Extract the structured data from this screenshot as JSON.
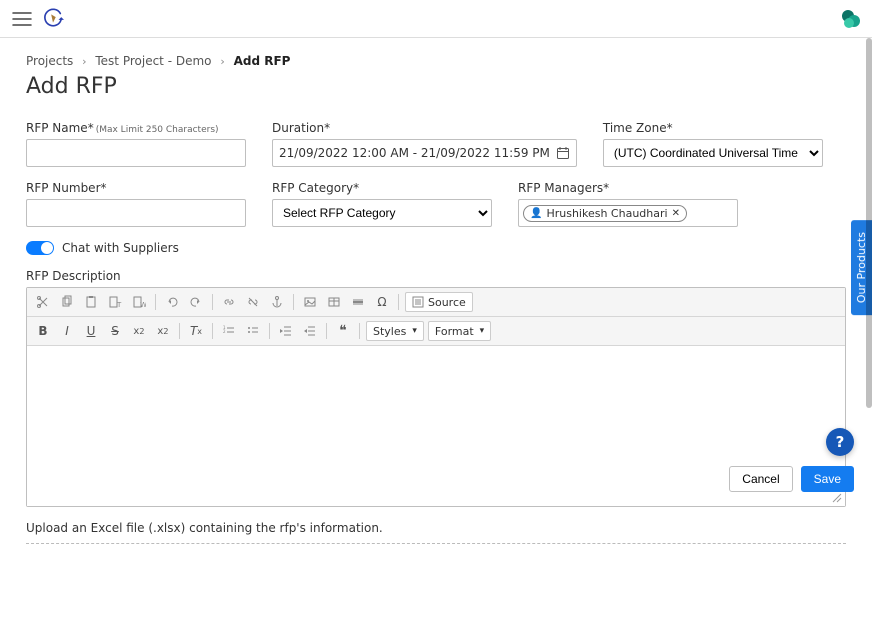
{
  "breadcrumb": {
    "item0": "Projects",
    "item1": "Test Project - Demo",
    "item2": "Add RFP"
  },
  "page_title": "Add RFP",
  "fields": {
    "rfp_name": {
      "label": "RFP Name*",
      "hint": "(Max Limit 250 Characters)",
      "value": ""
    },
    "rfp_number": {
      "label": "RFP Number*",
      "value": ""
    },
    "duration": {
      "label": "Duration*",
      "value": "21/09/2022 12:00 AM - 21/09/2022 11:59 PM"
    },
    "rfp_category": {
      "label": "RFP Category*",
      "placeholder": "Select RFP Category"
    },
    "time_zone": {
      "label": "Time Zone*",
      "value": "(UTC) Coordinated Universal Time"
    },
    "rfp_managers": {
      "label": "RFP Managers*",
      "chip": "Hrushikesh Chaudhari"
    }
  },
  "toggle": {
    "label": "Chat with Suppliers"
  },
  "desc_label": "RFP Description",
  "editor": {
    "source_btn": "Source",
    "styles_label": "Styles",
    "format_label": "Format"
  },
  "upload_note": "Upload an Excel file (.xlsx) containing the rfp's information.",
  "footer": {
    "cancel": "Cancel",
    "save": "Save"
  },
  "side_tab": "Our Products",
  "help": "?"
}
